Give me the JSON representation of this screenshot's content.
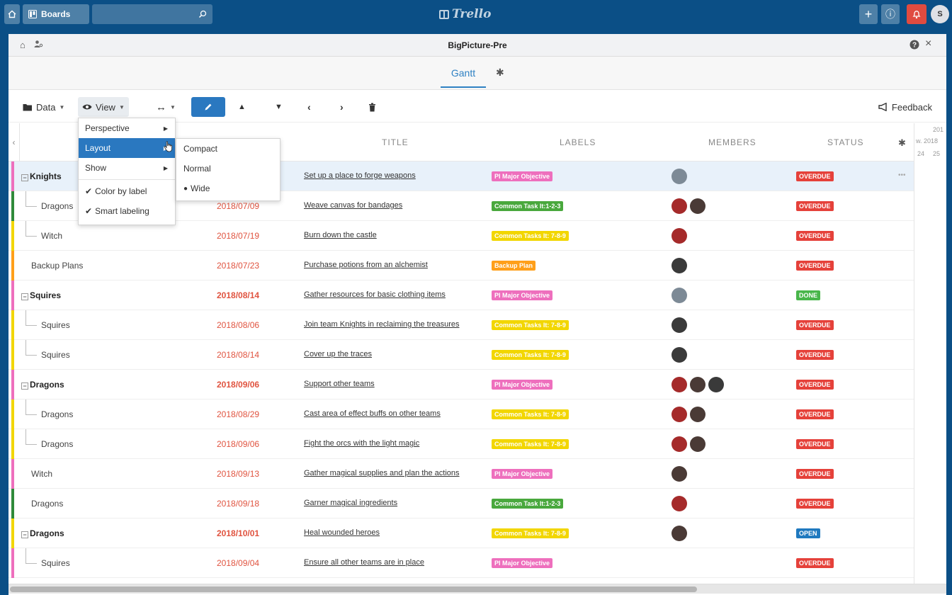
{
  "topbar": {
    "boards_label": "Boards",
    "logo_text": "Trello",
    "avatar_initial": "S"
  },
  "window": {
    "title": "BigPicture-Pre",
    "tabs": [
      {
        "label": "Gantt"
      }
    ]
  },
  "toolbar": {
    "data_label": "Data",
    "view_label": "View",
    "feedback_label": "Feedback"
  },
  "columns": {
    "title": "TITLE",
    "labels": "LABELS",
    "members": "MEMBERS",
    "status": "STATUS"
  },
  "timeline": {
    "year": "201",
    "month": "w. 2018",
    "day1": "24",
    "day2": "25"
  },
  "colors": {
    "pink": "#ee6fbd",
    "green": "#2f8a3a",
    "yellow": "#f2d600",
    "orange": "#ff9f1a",
    "overdue": "#e5413a",
    "done": "#49b64b",
    "open": "#1f79bf"
  },
  "rows": [
    {
      "name": "Knights",
      "group": true,
      "date": "",
      "title": "Set up a place to forge weapons",
      "label": "PI Major Objective",
      "label_color": "#ee6fbd",
      "bar": "#ee6fbd",
      "members": [
        "gray"
      ],
      "status": "OVERDUE",
      "status_color": "#e5413a"
    },
    {
      "name": "Dragons",
      "group": false,
      "date": "2018/07/09",
      "title": "Weave canvas for bandages",
      "label": "Common Task It:1-2-3",
      "label_color": "#49a83d",
      "bar": "#2f8a3a",
      "members": [
        "red",
        "brown"
      ],
      "status": "OVERDUE",
      "status_color": "#e5413a"
    },
    {
      "name": "Witch",
      "group": false,
      "date": "2018/07/19",
      "title": "Burn down the castle",
      "label": "Common Tasks It: 7-8-9",
      "label_color": "#f2d600",
      "bar": "#f2d600",
      "members": [
        "red"
      ],
      "status": "OVERDUE",
      "status_color": "#e5413a"
    },
    {
      "name": "Backup Plans",
      "group": false,
      "date": "2018/07/23",
      "title": "Purchase potions from an alchemist",
      "label": "Backup Plan",
      "label_color": "#ff9f1a",
      "bar": "#ff9f1a",
      "members": [
        "dark"
      ],
      "status": "OVERDUE",
      "status_color": "#e5413a"
    },
    {
      "name": "Squires",
      "group": true,
      "date": "2018/08/14",
      "title": "Gather resources for basic clothing items",
      "label": "PI Major Objective",
      "label_color": "#ee6fbd",
      "bar": "#ee6fbd",
      "members": [
        "gray"
      ],
      "status": "DONE",
      "status_color": "#49b64b"
    },
    {
      "name": "Squires",
      "group": false,
      "date": "2018/08/06",
      "title": "Join team Knights in reclaiming the treasures",
      "label": "Common Tasks It: 7-8-9",
      "label_color": "#f2d600",
      "bar": "#f2d600",
      "members": [
        "dark"
      ],
      "status": "OVERDUE",
      "status_color": "#e5413a"
    },
    {
      "name": "Squires",
      "group": false,
      "date": "2018/08/14",
      "title": "Cover up the traces",
      "label": "Common Tasks It: 7-8-9",
      "label_color": "#f2d600",
      "bar": "#f2d600",
      "members": [
        "dark"
      ],
      "status": "OVERDUE",
      "status_color": "#e5413a"
    },
    {
      "name": "Dragons",
      "group": true,
      "date": "2018/09/06",
      "title": "Support other teams",
      "label": "PI Major Objective",
      "label_color": "#ee6fbd",
      "bar": "#ee6fbd",
      "members": [
        "red",
        "brown",
        "dark"
      ],
      "status": "OVERDUE",
      "status_color": "#e5413a"
    },
    {
      "name": "Dragons",
      "group": false,
      "date": "2018/08/29",
      "title": "Cast area of effect buffs on other teams",
      "label": "Common Tasks It: 7-8-9",
      "label_color": "#f2d600",
      "bar": "#f2d600",
      "members": [
        "red",
        "brown"
      ],
      "status": "OVERDUE",
      "status_color": "#e5413a"
    },
    {
      "name": "Dragons",
      "group": false,
      "date": "2018/09/06",
      "title": "Fight the orcs with the light magic",
      "label": "Common Tasks It: 7-8-9",
      "label_color": "#f2d600",
      "bar": "#f2d600",
      "members": [
        "red",
        "brown"
      ],
      "status": "OVERDUE",
      "status_color": "#e5413a"
    },
    {
      "name": "Witch",
      "group": false,
      "date": "2018/09/13",
      "title": "Gather magical supplies and plan the actions",
      "label": "PI Major Objective",
      "label_color": "#ee6fbd",
      "bar": "#ee6fbd",
      "members": [
        "brown"
      ],
      "status": "OVERDUE",
      "status_color": "#e5413a"
    },
    {
      "name": "Dragons",
      "group": false,
      "date": "2018/09/18",
      "title": "Garner magical ingredients",
      "label": "Common Task It:1-2-3",
      "label_color": "#49a83d",
      "bar": "#2f8a3a",
      "members": [
        "red"
      ],
      "status": "OVERDUE",
      "status_color": "#e5413a"
    },
    {
      "name": "Dragons",
      "group": true,
      "date": "2018/10/01",
      "title": "Heal wounded heroes",
      "label": "Common Tasks It: 7-8-9",
      "label_color": "#f2d600",
      "bar": "#f2d600",
      "members": [
        "brown"
      ],
      "status": "OPEN",
      "status_color": "#1f79bf"
    },
    {
      "name": "Squires",
      "group": false,
      "date": "2018/09/04",
      "title": "Ensure all other teams are in place",
      "label": "PI Major Objective",
      "label_color": "#ee6fbd",
      "bar": "#ee6fbd",
      "members": [],
      "status": "OVERDUE",
      "status_color": "#e5413a"
    }
  ],
  "view_menu": {
    "items": [
      "Perspective",
      "Layout",
      "Show",
      "Color by label",
      "Smart labeling"
    ]
  },
  "layout_submenu": {
    "items": [
      "Compact",
      "Normal",
      "Wide"
    ]
  }
}
